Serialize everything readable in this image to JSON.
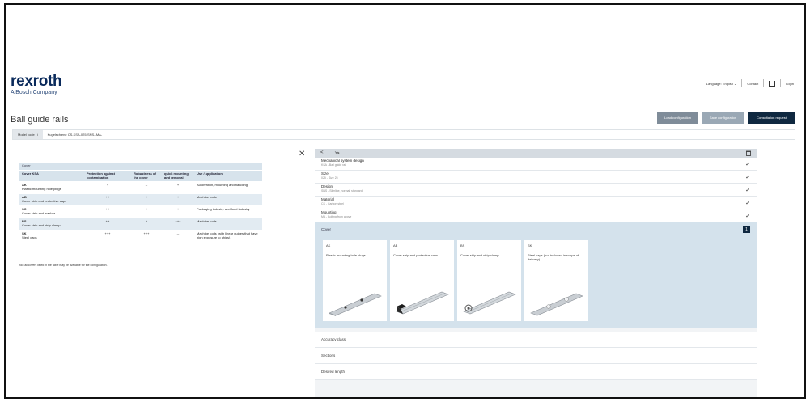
{
  "brand": {
    "name": "rexroth",
    "tagline": "A Bosch Company"
  },
  "header": {
    "language": "Language: English ⌄",
    "contact": "Contact",
    "login": "Login"
  },
  "page": {
    "title": "Ball guide rails"
  },
  "actions": {
    "load": "Load configuration",
    "save": "Save configuration",
    "consult": "Consultation request"
  },
  "model_code": {
    "label": "Model code",
    "info": "i",
    "value": "Kugelschiene CS-KSA-025-SNS--MA-"
  },
  "cover_table": {
    "title": "Cover",
    "columns": [
      "Cover KSA",
      "Protection against contamination",
      "Robustness of the cover",
      "quick mounting and removal",
      "Use / application"
    ],
    "rows": [
      {
        "code": "AK",
        "name": "Plastic mounting hole plugs",
        "protection": "+",
        "robustness": "–",
        "mounting": "+",
        "use": "Automation, mounting and handling"
      },
      {
        "code": "AB",
        "name": "Cover strip and protective caps",
        "protection": "++",
        "robustness": "+",
        "mounting": "+++",
        "use": "Machine tools"
      },
      {
        "code": "SC",
        "name": "Cover strip and washer",
        "protection": "++",
        "robustness": "+",
        "mounting": "+++",
        "use": "Packaging industry and food industry"
      },
      {
        "code": "BS",
        "name": "Cover strip and strip clamp",
        "protection": "++",
        "robustness": "+",
        "mounting": "+++",
        "use": "Machine tools"
      },
      {
        "code": "SK",
        "name": "Steel caps",
        "protection": "+++",
        "robustness": "+++",
        "mounting": "--",
        "use": "Machine tools (with linear guides that have high exposure to chips)"
      }
    ],
    "footnote": "Not all covers listed in the table may be available for the configuration."
  },
  "panel": {
    "nav_prev": "<",
    "nav_next": "≫",
    "sections": [
      {
        "title": "Mechanical system design",
        "sub": "KSA - Ball guide rail"
      },
      {
        "title": "Size",
        "sub": "025 - Size 25"
      },
      {
        "title": "Design",
        "sub": "SNS - Slimline, normal, standard"
      },
      {
        "title": "Material",
        "sub": "CS - Carbon steel"
      },
      {
        "title": "Mounting",
        "sub": "MA - Bolting from above"
      }
    ],
    "cover": {
      "title": "Cover",
      "badge": "1"
    },
    "cards": [
      {
        "code": "AK",
        "name": "Plastic mounting hole plugs"
      },
      {
        "code": "AB",
        "name": "Cover strip and protective caps"
      },
      {
        "code": "BS",
        "name": "Cover strip and strip clamp"
      },
      {
        "code": "SK",
        "name": "Steel caps (not included in scope of delivery)"
      }
    ],
    "remaining": [
      "Accuracy class",
      "Sections",
      "Desired length"
    ]
  },
  "icons": {
    "close": "close-icon",
    "cart": "cart-icon",
    "trash": "trash-icon",
    "check": "check-icon"
  },
  "colors": {
    "brand": "#0a2a5b",
    "primary_button": "#0f2840",
    "cover_bg": "#d4e2ec"
  }
}
